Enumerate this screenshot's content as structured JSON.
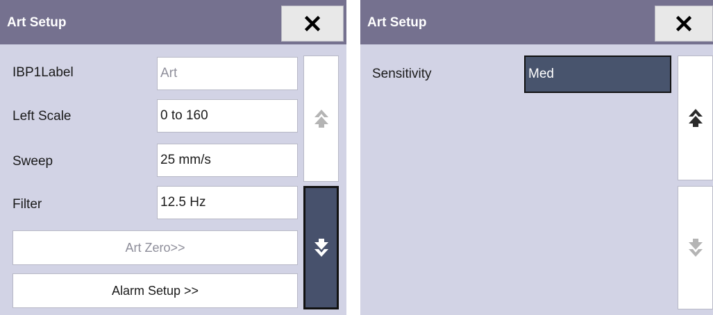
{
  "colors": {
    "title_bar": "#75718f",
    "background": "#d2d3e5",
    "selected": "#48546d",
    "field": "#ffffff"
  },
  "left_panel": {
    "title": "Art Setup",
    "close_icon": "close-icon",
    "rows": [
      {
        "label": "IBP1Label",
        "value": "Art"
      },
      {
        "label": "Left Scale",
        "value": "0 to 160"
      },
      {
        "label": "Sweep",
        "value": "25 mm/s"
      },
      {
        "label": "Filter",
        "value": "12.5 Hz"
      }
    ],
    "buttons": [
      {
        "label": "Art Zero>>"
      },
      {
        "label": "Alarm Setup >>"
      }
    ],
    "scroll_up_icon": "double-arrow-up-icon",
    "scroll_down_icon": "double-arrow-down-icon"
  },
  "right_panel": {
    "title": "Art Setup",
    "close_icon": "close-icon",
    "rows": [
      {
        "label": "Sensitivity",
        "value": "Med"
      }
    ],
    "scroll_up_icon": "double-arrow-up-icon",
    "scroll_down_icon": "double-arrow-down-icon"
  }
}
